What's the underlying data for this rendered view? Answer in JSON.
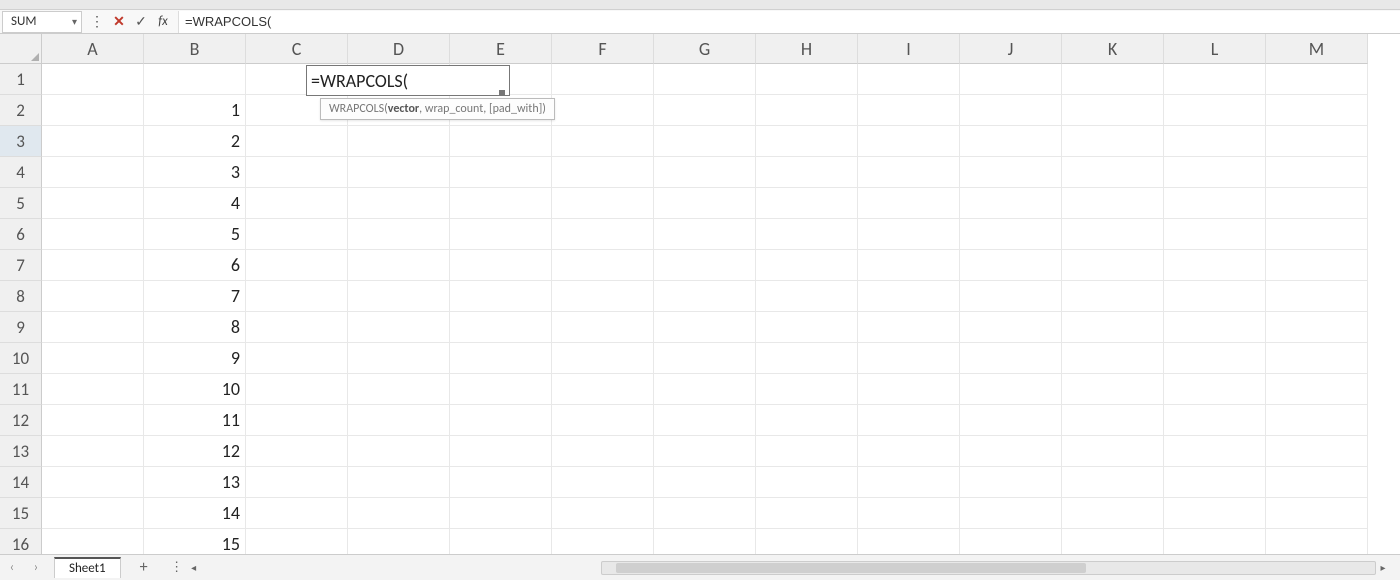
{
  "name_box": "SUM",
  "formula_bar": "=WRAPCOLS(",
  "columns": [
    "A",
    "B",
    "C",
    "D",
    "E",
    "F",
    "G",
    "H",
    "I",
    "J",
    "K",
    "L",
    "M"
  ],
  "rows": [
    "1",
    "2",
    "3",
    "4",
    "5",
    "6",
    "7",
    "8",
    "9",
    "10",
    "11",
    "12",
    "13",
    "14",
    "15",
    "16"
  ],
  "active_row": "3",
  "col_b_values": [
    "",
    "1",
    "2",
    "3",
    "4",
    "5",
    "6",
    "7",
    "8",
    "9",
    "10",
    "11",
    "12",
    "13",
    "14",
    "15"
  ],
  "edit_cell": {
    "ref": "D3",
    "text": "=WRAPCOLS("
  },
  "tooltip": {
    "fn": "WRAPCOLS",
    "arg_bold": "vector",
    "rest": ", wrap_count, [pad_with])"
  },
  "sheet_tab": "Sheet1",
  "chart_data": null
}
